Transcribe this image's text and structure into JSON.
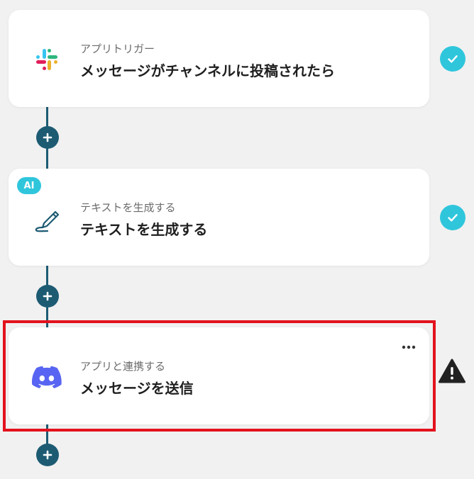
{
  "flow": {
    "steps": [
      {
        "icon": "slack-icon",
        "subtitle": "アプリトリガー",
        "title": "メッセージがチャンネルに投稿されたら",
        "status": "completed"
      },
      {
        "icon": "pencil-icon",
        "badge": "AI",
        "subtitle": "テキストを生成する",
        "title": "テキストを生成する",
        "status": "completed"
      },
      {
        "icon": "discord-icon",
        "subtitle": "アプリと連携する",
        "title": "メッセージを送信",
        "status": "warning",
        "highlighted": true
      }
    ]
  },
  "colors": {
    "connector": "#1d5b73",
    "check": "#2fc6dc",
    "highlight": "#e3121e",
    "discord": "#5865F2"
  }
}
